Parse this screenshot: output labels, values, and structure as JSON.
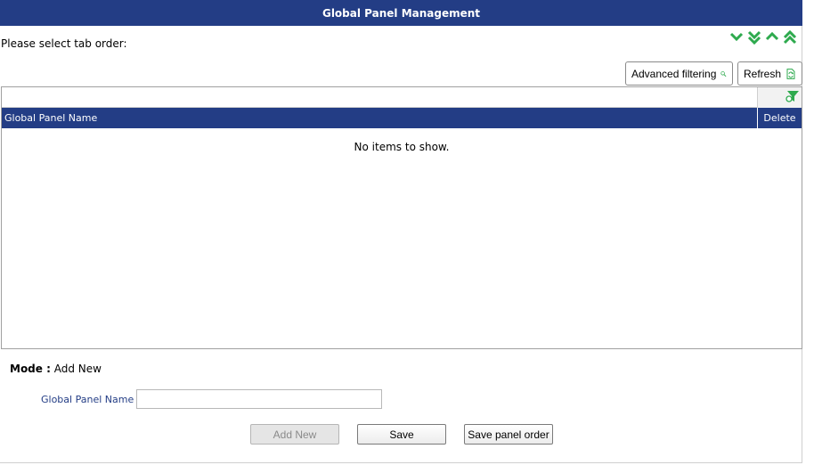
{
  "header": {
    "title": "Global Panel Management"
  },
  "tab_order": {
    "prompt": "Please select tab order:",
    "arrows": [
      "chevron-down-icon",
      "double-chevron-down-icon",
      "chevron-up-icon",
      "double-chevron-up-icon"
    ],
    "arrow_color": "#2eaa4e"
  },
  "toolbar": {
    "advanced_filtering_label": "Advanced filtering",
    "refresh_label": "Refresh"
  },
  "grid": {
    "columns": [
      "Global Panel Name",
      "Delete"
    ],
    "empty_message": "No items to show.",
    "header_color": "#233d85"
  },
  "form": {
    "mode_label": "Mode :",
    "mode_value": "Add New",
    "panel_name_label": "Global Panel Name :",
    "panel_name_value": "",
    "buttons": {
      "add_new": "Add New",
      "save": "Save",
      "save_panel_order": "Save panel order"
    }
  }
}
